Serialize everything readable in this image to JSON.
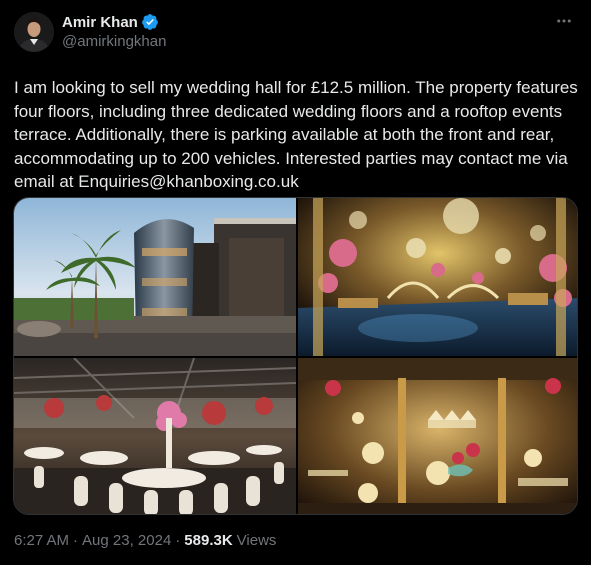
{
  "author": {
    "display_name": "Amir Khan",
    "handle": "@amirkingkhan",
    "verified": true,
    "avatar_icon": "profile-photo"
  },
  "tweet": {
    "text": "I am looking to sell my wedding hall for £12.5 million. The property features four floors, including three dedicated wedding floors and a rooftop events terrace. Additionally, there is parking available at both the front and rear, accommodating up to 200 vehicles. Interested parties may contact me via email at Enquiries@khanboxing.co.uk"
  },
  "media": {
    "count": 4,
    "images": [
      "building-exterior",
      "wedding-hall-interior-gold",
      "banquet-tables-interior",
      "chandelier-floor-interior"
    ]
  },
  "meta": {
    "time": "6:27 AM",
    "date": "Aug 23, 2024",
    "views": "589.3K",
    "views_label": "Views"
  },
  "colors": {
    "background": "#000000",
    "text": "#e7e9ea",
    "secondary_text": "#71767b",
    "verified_badge": "#1d9bf0",
    "border": "#2f3336"
  },
  "icons": {
    "more": "more-horizontal-icon",
    "verified": "verified-badge-icon"
  }
}
